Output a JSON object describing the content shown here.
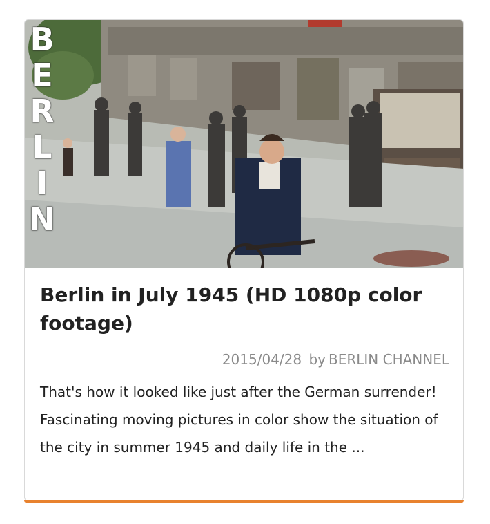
{
  "card": {
    "thumbnail": {
      "overlay_letters": [
        "B",
        "E",
        "R",
        "L",
        "I",
        "N"
      ]
    },
    "title": "Berlin in July 1945 (HD 1080p color footage)",
    "date": "2015/04/28",
    "by_label": "by",
    "author": "BERLIN CHANNEL",
    "excerpt": "That's how it looked like just after the German surrender! Fascinating moving pictures in color show the situation of the city in summer 1945 and daily life in the ..."
  },
  "colors": {
    "accent": "#e8822f",
    "title": "#222222",
    "meta": "#8a8a8a",
    "border": "#d9d9d9"
  }
}
